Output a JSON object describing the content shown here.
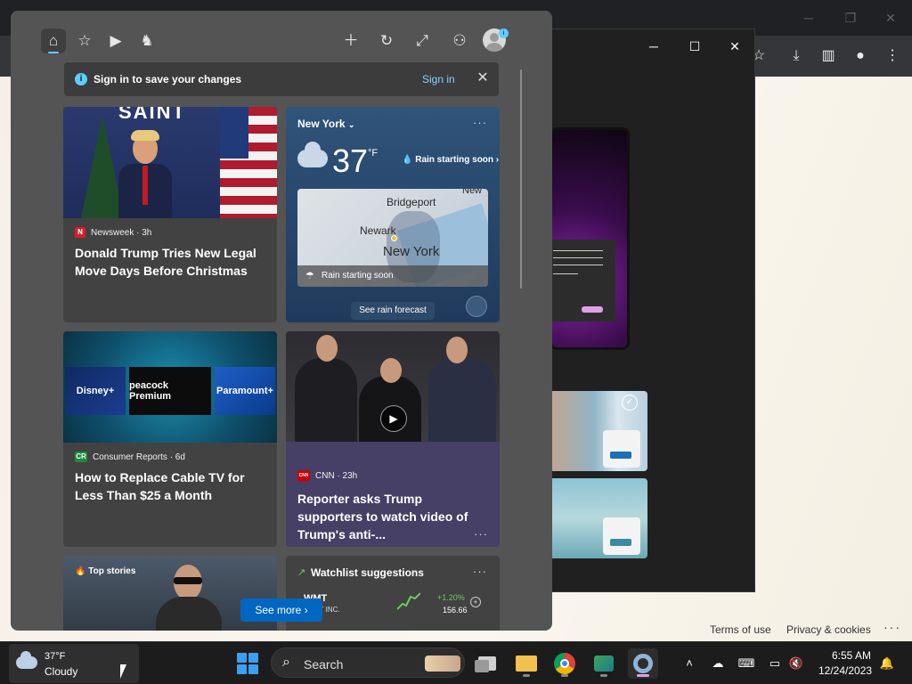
{
  "widgets": {
    "signin": {
      "message": "Sign in to save your changes",
      "link": "Sign in"
    },
    "news": [
      {
        "source": "Newsweek · 3h",
        "logo_letter": "N",
        "headline": "Donald Trump Tries New Legal Move Days Before Christmas",
        "image_text": "SAINT"
      },
      {
        "source": "Consumer Reports · 6d",
        "logo_letter": "CR",
        "headline": "How to Replace Cable TV for Less Than $25 a Month",
        "tiles": [
          "Disney+",
          "peacock Premium",
          "Paramount+"
        ]
      },
      {
        "source": "CNN · 23h",
        "logo_letter": "CNN",
        "headline": "Reporter asks Trump supporters to watch video of Trump's anti-..."
      }
    ],
    "weather": {
      "location": "New York",
      "temperature": "37",
      "unit": "°F",
      "rain_status": "Rain starting soon",
      "map_labels": [
        "Bridgeport",
        "Newark",
        "New York",
        "New"
      ],
      "map_strip": "Rain starting soon",
      "forecast_button": "See rain forecast"
    },
    "top_stories_label": "Top stories",
    "see_more": "See more",
    "watchlist": {
      "title": "Watchlist suggestions",
      "stock_symbol": "WMT",
      "stock_name": "MART INC.",
      "change": "+1.20%",
      "price": "156.66"
    }
  },
  "browser": {
    "footer_links": [
      "Terms of use",
      "Privacy & cookies"
    ]
  },
  "taskbar": {
    "weather_temp": "37°F",
    "weather_condition": "Cloudy",
    "search_placeholder": "Search",
    "clock_time": "6:55 AM",
    "clock_date": "12/24/2023"
  }
}
